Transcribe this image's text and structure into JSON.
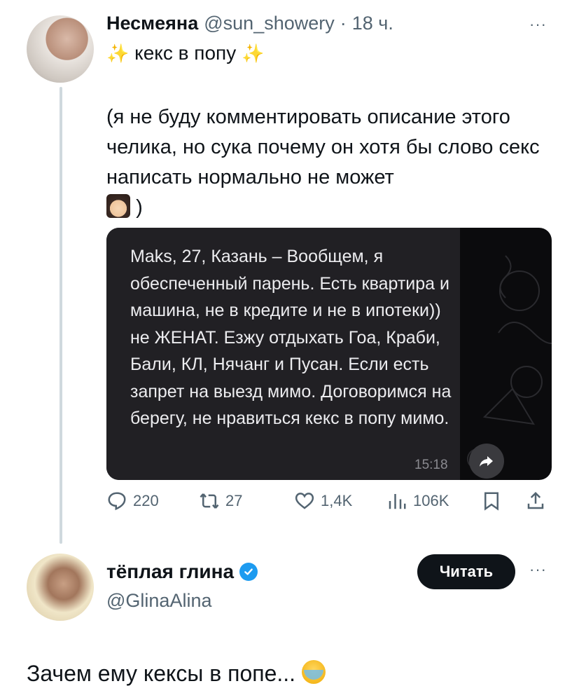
{
  "tweet1": {
    "display_name": "Несмеяна",
    "handle": "@sun_showery",
    "separator": "·",
    "time": "18 ч.",
    "more": "···",
    "title_sparkle_left": "✨",
    "title": "кекс в попу",
    "title_sparkle_right": "✨",
    "body": "(я не буду комментировать описание этого челика, но сука почему он хотя бы слово секс написать нормально не может",
    "body_end": ")",
    "media": {
      "message_text": "Maks, 27, Казань – Вообщем, я обеспеченный парень. Есть квартира и машина, не в кредите и не в ипотеки)) не ЖЕНАТ. Езжу отдыхать Гоа, Краби, Бали, КЛ, Нячанг и Пусан. Если есть запрет на выезд мимо. Договоримся на берегу, не нравиться кекс в попу мимо.",
      "message_time": "15:18"
    },
    "actions": {
      "replies": "220",
      "retweets": "27",
      "likes": "1,4K",
      "views": "106K"
    }
  },
  "tweet2": {
    "display_name": "тёплая глина",
    "handle": "@GlinaAlina",
    "follow_label": "Читать",
    "more": "···",
    "text": "Зачем ему кексы в попе..."
  },
  "colors": {
    "text": "#0f1419",
    "secondary": "#536471",
    "verified": "#1d9bf0",
    "thread_line": "#cfd9de",
    "bubble": "#212024"
  }
}
